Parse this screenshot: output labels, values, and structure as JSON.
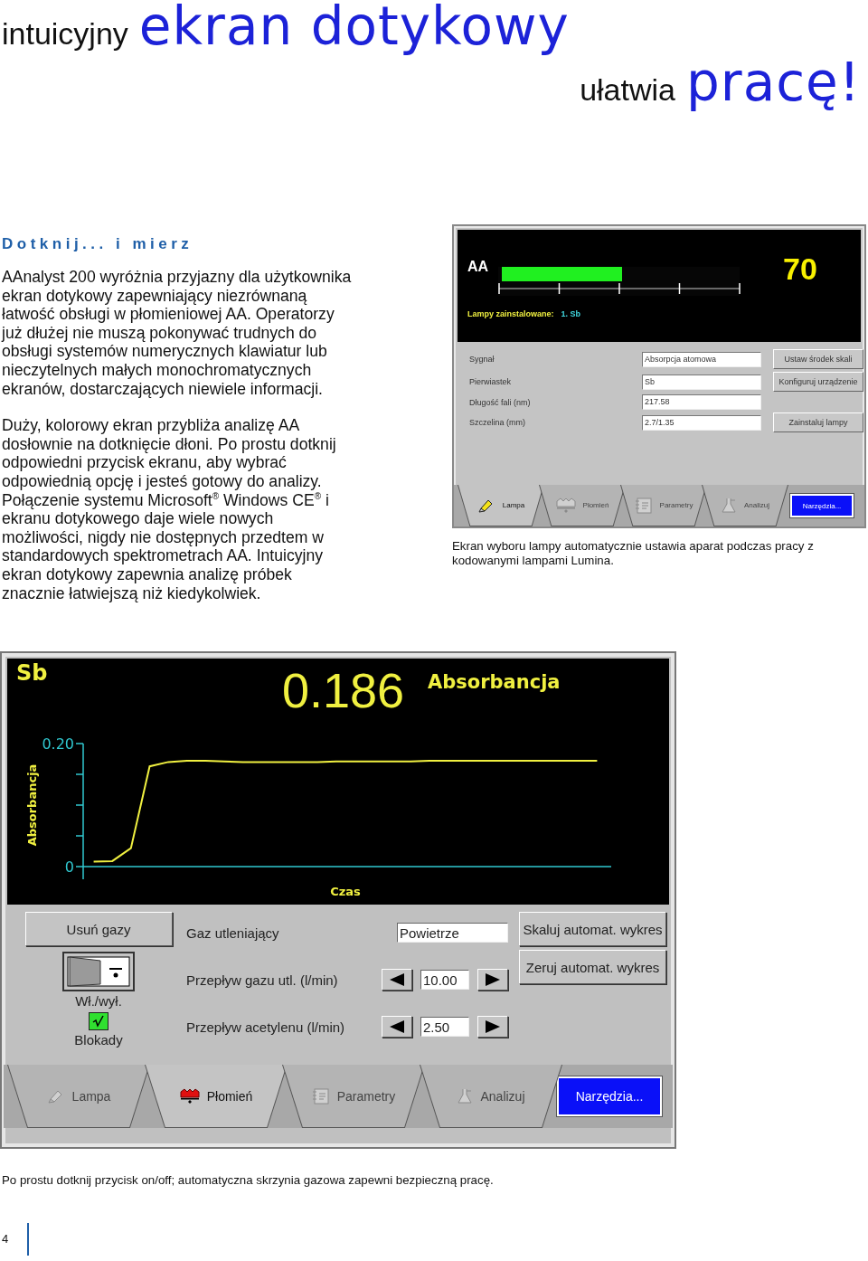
{
  "heading": {
    "small_1": "intuicyjny",
    "large_1": "ekran dotykowy",
    "small_2": "ułatwia",
    "large_2": "pracę!"
  },
  "section_title": "Dotknij... i mierz",
  "paragraphs": [
    "AAnalyst 200 wyróżnia przyjazny dla użytkownika ekran dotykowy  zapewniający niezrównaną łatwość obsługi w płomieniowej AA. Operatorzy już dłużej nie muszą pokonywać trudnych do obsługi systemów numerycznych klawiatur lub nieczytelnych małych monochromatycznych ekranów, dostarczających niewiele informacji.",
    "Duży, kolorowy ekran przybliża analizę AA dosłownie na dotknięcie dłoni. Po prostu dotknij odpowiedni przycisk ekranu, aby wybrać odpowiednią opcję i jesteś gotowy do analizy. Połączenie systemu Microsoft$^{®}$ Windows CE$^{®}$ i ekranu dotykowego daje wiele nowych możliwości, nigdy nie dostępnych przedtem w standardowych spektrometrach AA. Intuicyjny ekran dotykowy zapewnia analizę próbek znacznie łatwiejszą niż kiedykolwiek."
  ],
  "lamp_screen": {
    "signal_label": "AA",
    "level": 0.5,
    "reading": "70",
    "installed_label": "Lampy zainstalowane:",
    "installed_value": "1. Sb",
    "rows": [
      {
        "label": "Sygnał",
        "value": "Absorpcja atomowa",
        "button": "Ustaw środek skali"
      },
      {
        "label": "Pierwiastek",
        "value": "Sb",
        "button": "Konfiguruj urządzenie"
      },
      {
        "label": "Długość fali (nm)",
        "value": "217.58"
      },
      {
        "label": "Szczelina (mm)",
        "value": "2.7/1.35",
        "button": "Zainstaluj lampy"
      }
    ],
    "tabs": [
      {
        "label": "Lampa",
        "kind": "lamp",
        "selected": true
      },
      {
        "label": "Płomień",
        "kind": "flame",
        "selected": false
      },
      {
        "label": "Parametry",
        "kind": "params",
        "selected": false
      },
      {
        "label": "Analizuj",
        "kind": "analyze",
        "selected": false
      }
    ],
    "tools_button": "Narzędzia..."
  },
  "lamp_caption": "Ekran wyboru lampy automatycznie ustawia aparat podczas pracy z kodowanymi lampami Lumina.",
  "flame_screen": {
    "element": "Sb",
    "reading": "0.186",
    "reading_unit": "Absorbancja",
    "chart_data": {
      "type": "line",
      "xlabel": "Czas",
      "ylabel": "Absorbancja",
      "ylim": [
        0,
        0.2
      ],
      "yticks": [
        {
          "value": 0,
          "label": "0"
        },
        {
          "value": 0.2,
          "label": "0.20"
        }
      ],
      "categories": [
        null,
        null,
        null,
        null,
        null,
        null,
        null,
        null,
        null,
        null,
        null,
        null,
        null,
        null,
        null,
        null,
        null,
        null,
        null,
        null,
        null,
        null,
        null,
        null,
        null,
        null,
        null,
        null
      ],
      "series": [
        {
          "color": "#f0f040",
          "values": [
            0.008,
            0.009,
            0.03,
            0.163,
            0.17,
            0.172,
            0.172,
            0.171,
            0.17,
            0.17,
            0.17,
            0.17,
            0.17,
            0.171,
            0.171,
            0.171,
            0.171,
            0.171,
            0.172,
            0.172,
            0.172,
            0.172,
            0.172,
            0.172,
            0.172,
            0.172,
            0.172,
            0.172
          ]
        }
      ]
    },
    "purge_button": "Usuń gazy",
    "switch_label": "Wł./wył.",
    "interlock": {
      "label": "Blokady",
      "checked": true
    },
    "rows": [
      {
        "kind": "field",
        "label": "Gaz utleniający",
        "value": "Powietrze"
      },
      {
        "kind": "stepper",
        "label": "Przepływ gazu utl. (l/min)",
        "value": "10.00"
      },
      {
        "kind": "stepper",
        "label": "Przepływ acetylenu (l/min)",
        "value": "2.50"
      }
    ],
    "side_buttons": [
      "Skaluj automat. wykres",
      "Zeruj automat. wykres"
    ],
    "tabs": [
      {
        "label": "Lampa",
        "kind": "lamp",
        "selected": false
      },
      {
        "label": "Płomień",
        "kind": "flame",
        "selected": true
      },
      {
        "label": "Parametry",
        "kind": "params",
        "selected": false
      },
      {
        "label": "Analizuj",
        "kind": "analyze",
        "selected": false
      }
    ],
    "tools_button": "Narzędzia..."
  },
  "flame_caption": "Po prostu dotknij przycisk on/off; automatyczna skrzynia gazowa zapewni bezpieczną pracę.",
  "page_number": "4"
}
